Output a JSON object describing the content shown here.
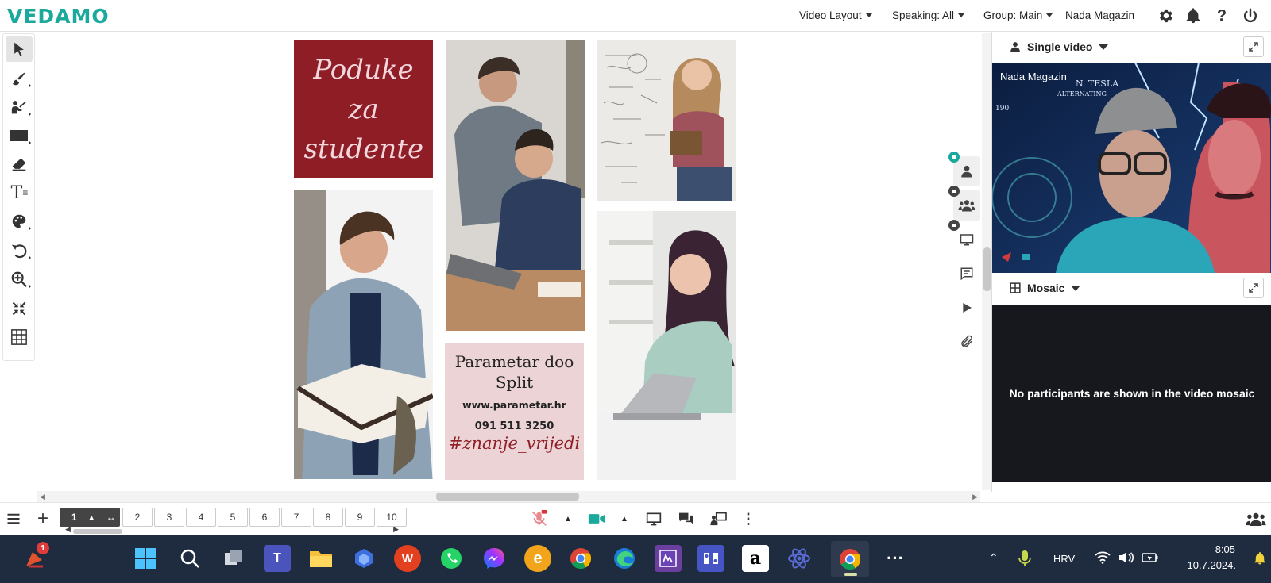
{
  "app": {
    "logo": "VEDAMO"
  },
  "header": {
    "video_layout": "Video Layout",
    "speaking": "Speaking: All",
    "group": "Group: Main",
    "user_name": "Nada Magazin"
  },
  "slide": {
    "poster_title": "Poduke za studente",
    "company": "Parametar doo Split",
    "website": "www.parametar.hr",
    "phone": "091 511 3250",
    "hashtag": "#znanje_vrijedi"
  },
  "right_panel": {
    "single_video_label": "Single video",
    "participant_name": "Nada Magazin",
    "mosaic_label": "Mosaic",
    "mosaic_empty": "No participants are shown in the video mosaic"
  },
  "pages": {
    "current": "1",
    "list": [
      "2",
      "3",
      "4",
      "5",
      "6",
      "7",
      "8",
      "9",
      "10"
    ]
  },
  "taskbar": {
    "notification_count": "1",
    "language": "HRV",
    "time": "8:05",
    "date": "10.7.2024."
  },
  "colors": {
    "brand": "#1ba99b",
    "poster_red": "#8f1d26",
    "poster_pink": "#ebd3d6",
    "taskbar": "#1f2b3e"
  }
}
